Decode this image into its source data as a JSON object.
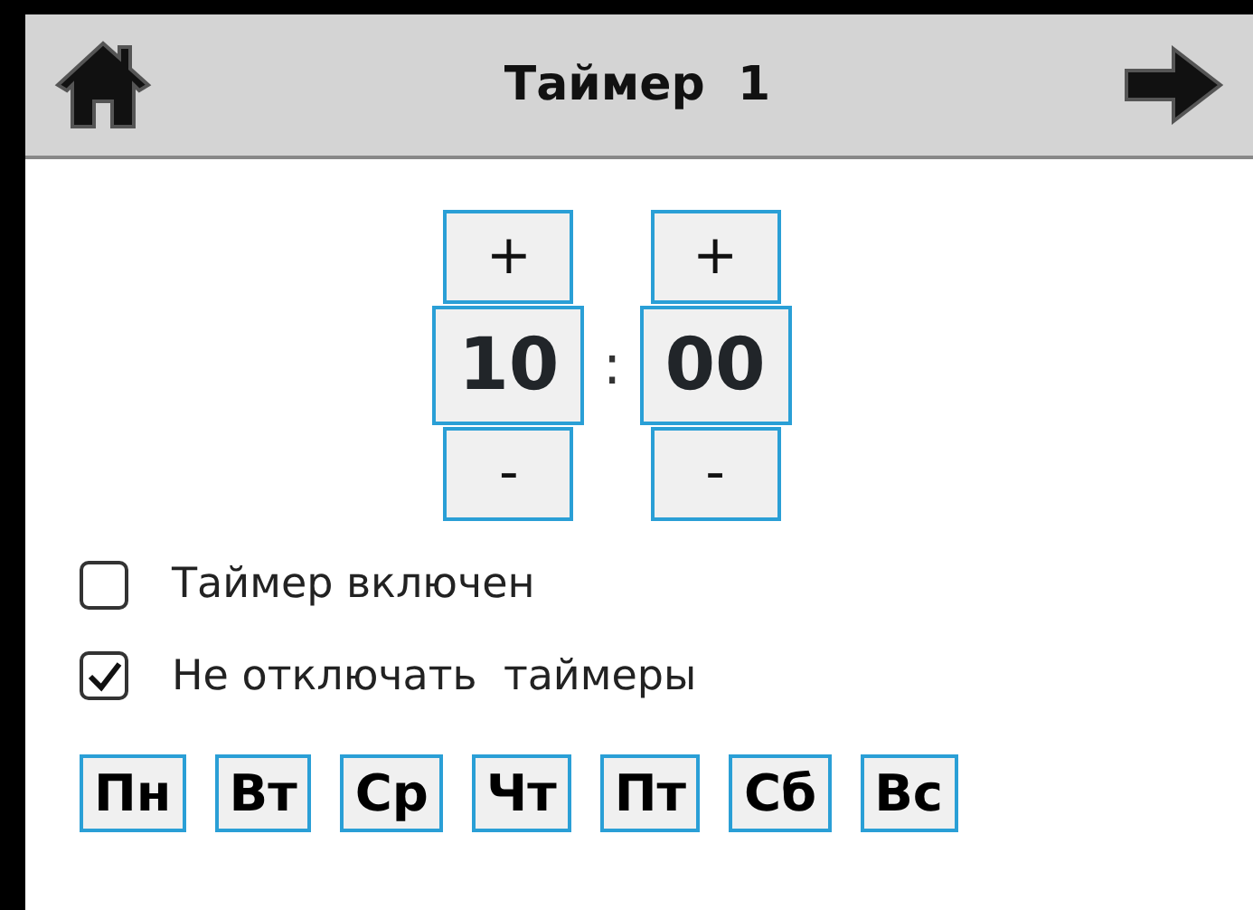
{
  "header": {
    "title": "Таймер  1"
  },
  "time": {
    "hours": {
      "plus": "+",
      "value": "10",
      "minus": "-"
    },
    "separator": ":",
    "minutes": {
      "plus": "+",
      "value": "00",
      "minus": "-"
    }
  },
  "options": [
    {
      "label": "Таймер включен",
      "checked": false
    },
    {
      "label": "Не отключать  таймеры",
      "checked": true
    }
  ],
  "days": [
    "Пн",
    "Вт",
    "Ср",
    "Чт",
    "Пт",
    "Сб",
    "Вс"
  ]
}
